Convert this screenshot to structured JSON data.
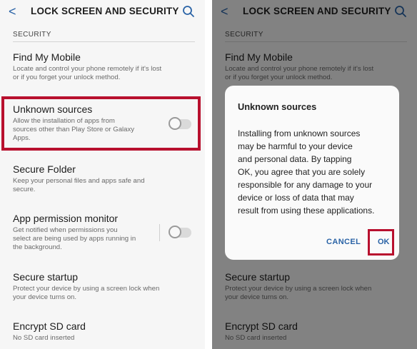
{
  "screen": {
    "back_glyph": "<",
    "title": "LOCK SCREEN AND SECURITY",
    "section_header": "SECURITY",
    "items": [
      {
        "title": "Find My Mobile",
        "desc": [
          "Locate and control your phone remotely if it's lost",
          "or if you forget your unlock method."
        ]
      },
      {
        "title": "Unknown sources",
        "desc": [
          "Allow the installation of apps from",
          "sources other than Play Store or Galaxy",
          "Apps."
        ],
        "toggle": "off"
      },
      {
        "title": "Secure Folder",
        "desc": [
          "Keep your personal files and apps safe and",
          "secure."
        ]
      },
      {
        "title": "App permission monitor",
        "desc": [
          "Get notified when permissions you",
          "select are being used by apps running in",
          "the background."
        ],
        "toggle": "off"
      },
      {
        "title": "Secure startup",
        "desc": [
          "Protect your device by using a screen lock when",
          "your device turns on."
        ]
      },
      {
        "title": "Encrypt SD card",
        "desc": [
          "No SD card inserted"
        ]
      }
    ]
  },
  "dialog": {
    "title": "Unknown sources",
    "body": [
      "Installing from unknown sources",
      "may be harmful to your device",
      "and personal data. By tapping",
      "OK, you agree that you are solely",
      "responsible for any damage to your",
      "device or loss of data that may",
      "result from using these applications."
    ],
    "cancel_label": "CANCEL",
    "ok_label": "OK"
  },
  "colors": {
    "accent": "#2a63a6",
    "highlight": "#b8102e",
    "panel_bg": "#f6f6f6"
  },
  "icons": {
    "back": "back-arrow-icon",
    "search": "search-icon"
  }
}
